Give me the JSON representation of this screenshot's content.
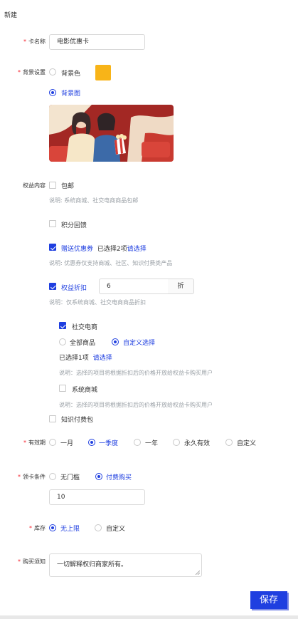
{
  "page_title": "新建",
  "card_name": {
    "label": "卡名称",
    "value": "电影优惠卡"
  },
  "background": {
    "label": "背景设置",
    "option_color": "背景色",
    "option_image": "背景图",
    "color": "#f8b418",
    "selected": "背景图"
  },
  "benefits": {
    "label": "权益内容",
    "free_shipping": {
      "label": "包邮",
      "checked": false,
      "hint": "说明: 系统商城、社交电商商品包邮"
    },
    "points": {
      "label": "积分回馈",
      "checked": false
    },
    "coupon": {
      "label": "赠送优惠券",
      "checked": true,
      "selected_text": "已选择2项",
      "select_link": "请选择",
      "hint": "说明: 优惠券仅支持商城、社区、知识付费类产品"
    },
    "discount": {
      "label": "权益折扣",
      "checked": true,
      "value": "6",
      "suffix": "折",
      "hint": "说明：仅系统商城、社交电商商品折扣",
      "social": {
        "label": "社交电商",
        "checked": true,
        "option_all": "全部商品",
        "option_custom": "自定义选择",
        "selected": "自定义选择",
        "selected_text": "已选择1项",
        "select_link": "请选择",
        "hint": "说明：选择的项目将根据折扣后的价格开放给权益卡购买用户"
      },
      "system": {
        "label": "系统商城",
        "checked": false,
        "hint": "说明：选择的项目将根据折扣后的价格开放给权益卡购买用户"
      }
    },
    "knowledge": {
      "label": "知识付费包",
      "checked": false
    }
  },
  "validity": {
    "label": "有效期",
    "options": [
      "一月",
      "一季度",
      "一年",
      "永久有效",
      "自定义"
    ],
    "selected": "一季度"
  },
  "claim": {
    "label": "领卡条件",
    "option_free": "无门槛",
    "option_paid": "付费购买",
    "selected": "付费购买",
    "price": "10"
  },
  "stock": {
    "label": "库存",
    "option_unlimited": "无上限",
    "option_custom": "自定义",
    "selected": "无上限"
  },
  "notice": {
    "label": "购买须知",
    "value": "一切解释权归商家所有。"
  },
  "save_label": "保存",
  "colors": {
    "primary": "#1f3fe0",
    "required": "#f5222d",
    "hint": "#9aa0a6"
  }
}
